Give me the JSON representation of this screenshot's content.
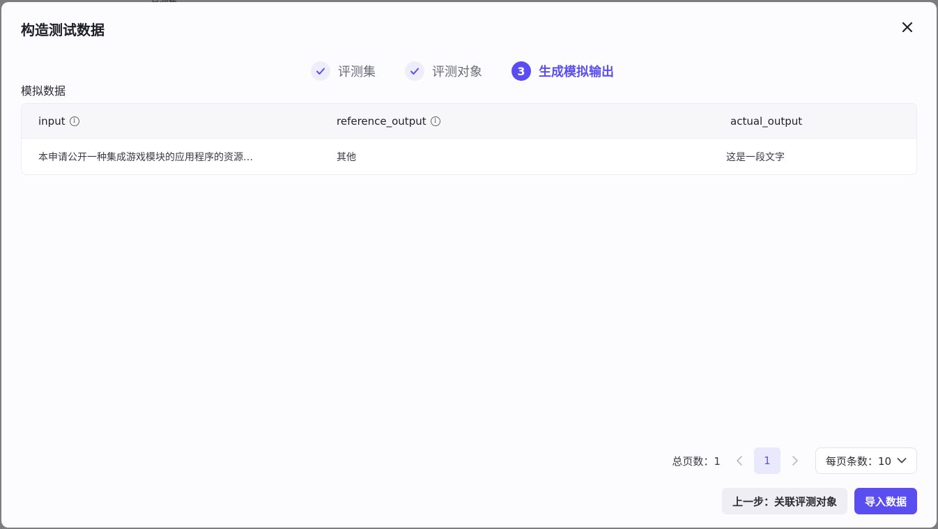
{
  "backdrop": {
    "text": "且测集"
  },
  "modal": {
    "title": "构造测试数据",
    "close_icon": "close-icon"
  },
  "steps": [
    {
      "label": "评测集",
      "status": "done",
      "icon": "check-icon"
    },
    {
      "label": "评测对象",
      "status": "done",
      "icon": "check-icon"
    },
    {
      "label": "生成模拟输出",
      "status": "active",
      "number": "3"
    }
  ],
  "section": {
    "label": "模拟数据"
  },
  "table": {
    "columns": [
      {
        "label": "input",
        "info": true
      },
      {
        "label": "reference_output",
        "info": true
      },
      {
        "label": "actual_output",
        "info": false
      }
    ],
    "rows": [
      {
        "input": "本申请公开一种集成游戏模块的应用程序的资源…",
        "reference_output": "其他",
        "actual_output": "这是一段文字"
      }
    ]
  },
  "pagination": {
    "total_label": "总页数：1",
    "current_page": "1",
    "page_size_label": "每页条数：10"
  },
  "footer": {
    "prev_label": "上一步：关联评测对象",
    "import_label": "导入数据"
  },
  "colors": {
    "accent": "#5a4ef0",
    "accent_light": "#eae8fc"
  }
}
